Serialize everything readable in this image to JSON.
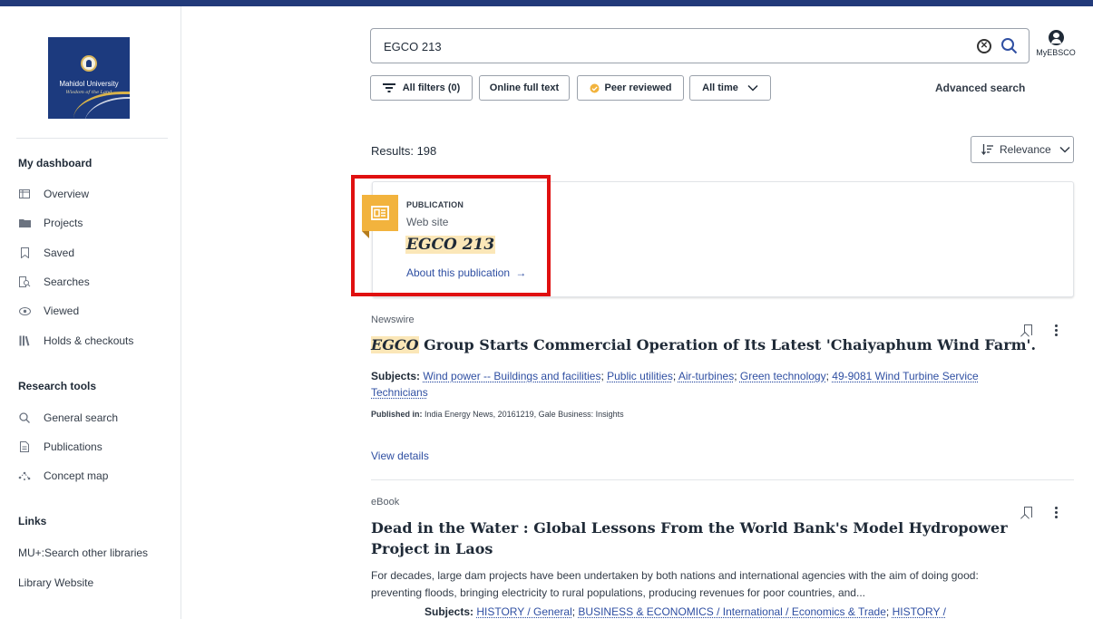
{
  "colors": {
    "brand": "#223a7a",
    "link": "#2f4fa2",
    "highlight": "#fbe7b8",
    "publication_flag": "#f2b33d",
    "annotation_box": "#e01010"
  },
  "logo": {
    "name": "Mahidol University",
    "tagline": "Wisdom of the Land"
  },
  "sidebar": {
    "dashboard_title": "My dashboard",
    "dashboard_items": [
      {
        "label": "Overview",
        "icon": "overview-icon"
      },
      {
        "label": "Projects",
        "icon": "folder-icon"
      },
      {
        "label": "Saved",
        "icon": "bookmark-icon"
      },
      {
        "label": "Searches",
        "icon": "search-history-icon"
      },
      {
        "label": "Viewed",
        "icon": "eye-icon"
      },
      {
        "label": "Holds & checkouts",
        "icon": "books-icon"
      }
    ],
    "tools_title": "Research tools",
    "tools_items": [
      {
        "label": "General search",
        "icon": "search-icon"
      },
      {
        "label": "Publications",
        "icon": "document-icon"
      },
      {
        "label": "Concept map",
        "icon": "concept-map-icon"
      }
    ],
    "links_title": "Links",
    "links": [
      "MU+:Search other libraries",
      "Library Website"
    ]
  },
  "search": {
    "query": "EGCO 213",
    "myebsco_label": "MyEBSCO"
  },
  "filters": {
    "all_filters": "All filters (0)",
    "online_full_text": "Online full text",
    "peer_reviewed": "Peer reviewed",
    "all_time": "All time",
    "advanced_search": "Advanced search"
  },
  "results": {
    "count": "Results: 198",
    "sort": "Relevance"
  },
  "publication": {
    "type": "PUBLICATION",
    "subtype": "Web site",
    "title": "EGCO 213",
    "about": "About this publication"
  },
  "items": [
    {
      "type": "Newswire",
      "title_highlight": "EGCO",
      "title_rest": " Group Starts Commercial Operation of Its Latest 'Chaiyaphum Wind Farm'.",
      "subjects_label": "Subjects:",
      "subjects": [
        "Wind power -- Buildings and facilities",
        "Public utilities",
        "Air-turbines",
        "Green technology",
        "49-9081 Wind Turbine Service Technicians"
      ],
      "published_label": "Published in:",
      "published": "India Energy News, 20161219, Gale Business: Insights",
      "view_details": "View details"
    },
    {
      "type": "eBook",
      "title": "Dead in the Water : Global Lessons From the World Bank's Model Hydropower Project in Laos",
      "abstract": "For decades, large dam projects have been undertaken by both nations and international agencies with the aim of doing good: preventing floods, bringing electricity to rural populations, producing revenues for poor countries, and...",
      "subjects_label": "Subjects:",
      "subjects": [
        "HISTORY / General",
        "BUSINESS & ECONOMICS / International / Economics & Trade",
        "HISTORY /"
      ]
    }
  ]
}
